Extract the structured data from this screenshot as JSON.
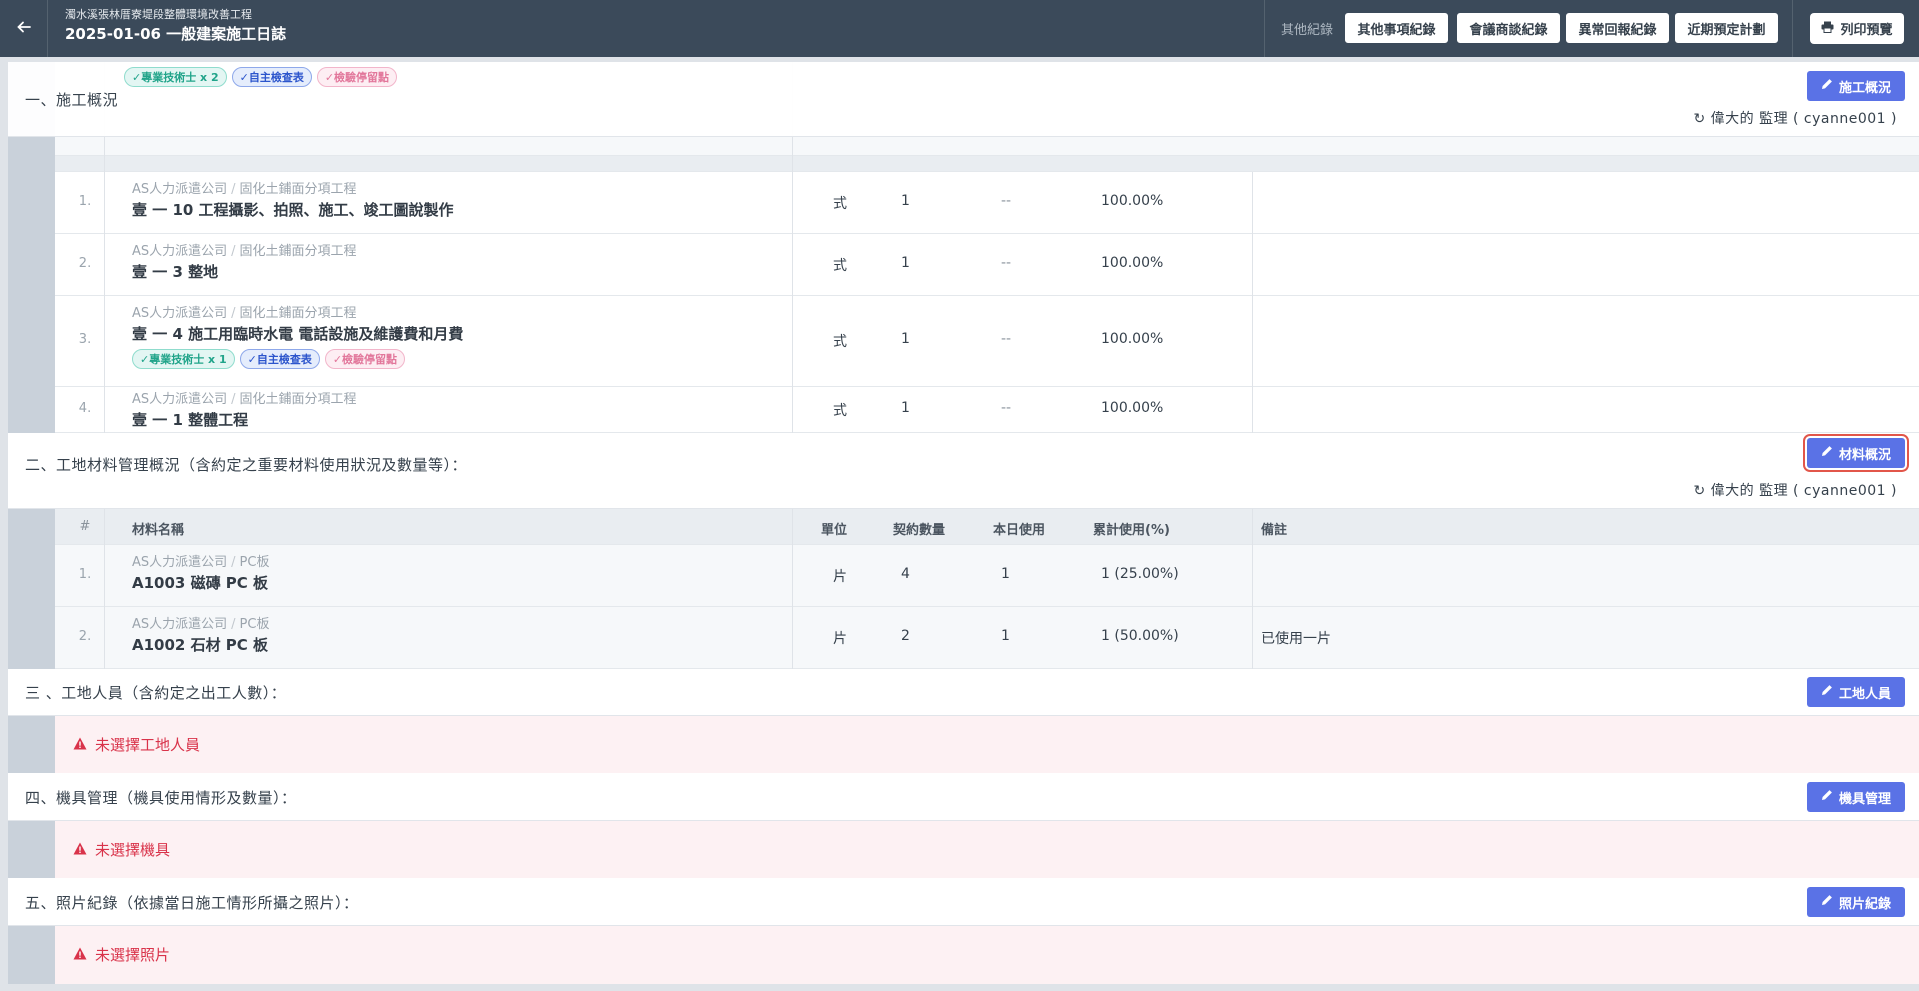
{
  "header": {
    "subtitle": "濁水溪張林厝寮堤段整體環境改善工程",
    "title": "2025-01-06 一般建案施工日誌",
    "other_records_label": "其他紀錄",
    "buttons": [
      "其他事項紀錄",
      "會議商談紀錄",
      "異常回報紀錄",
      "近期預定計劃"
    ],
    "print_label": "列印預覽"
  },
  "section1": {
    "label": "一、施工概況",
    "button": "施工概況",
    "supervisor": "偉大的 監理 ( cyanne001 )",
    "top_tags": [
      "✓專業技術士 x 2",
      "✓自主檢查表",
      "✓檢驗停留點"
    ],
    "rows": [
      {
        "no": "1.",
        "company": "AS人力派遣公司",
        "category": "固化土鋪面分項工程",
        "name": "壹 一 10 工程攝影、拍照、施工、竣工圖說製作",
        "unit": "式",
        "qty": "1",
        "today": "--",
        "cum": "100.00%"
      },
      {
        "no": "2.",
        "company": "AS人力派遣公司",
        "category": "固化土鋪面分項工程",
        "name": "壹 一 3 整地",
        "unit": "式",
        "qty": "1",
        "today": "--",
        "cum": "100.00%"
      },
      {
        "no": "3.",
        "company": "AS人力派遣公司",
        "category": "固化土鋪面分項工程",
        "name": "壹 一 4 施工用臨時水電 電話設施及維護費和月費",
        "unit": "式",
        "qty": "1",
        "today": "--",
        "cum": "100.00%",
        "tags": [
          "✓專業技術士 x 1",
          "✓自主檢查表",
          "✓檢驗停留點"
        ]
      },
      {
        "no": "4.",
        "company": "AS人力派遣公司",
        "category": "固化土鋪面分項工程",
        "name": "壹 一 1 整體工程",
        "unit": "式",
        "qty": "1",
        "today": "--",
        "cum": "100.00%"
      }
    ]
  },
  "section2": {
    "label": "二、工地材料管理概況（含約定之重要材料使用狀況及數量等）：",
    "button": "材料概況",
    "supervisor": "偉大的 監理 ( cyanne001 )",
    "columns": {
      "no": "#",
      "name": "材料名稱",
      "unit": "單位",
      "qty": "契約數量",
      "today": "本日使用",
      "cum": "累計使用(%)",
      "note": "備註"
    },
    "rows": [
      {
        "no": "1.",
        "company": "AS人力派遣公司",
        "category": "PC板",
        "name": "A1003 磁磚 PC 板",
        "unit": "片",
        "qty": "4",
        "today": "1",
        "cum": "1 (25.00%)",
        "note": ""
      },
      {
        "no": "2.",
        "company": "AS人力派遣公司",
        "category": "PC板",
        "name": "A1002 石材 PC 板",
        "unit": "片",
        "qty": "2",
        "today": "1",
        "cum": "1 (50.00%)",
        "note": "已使用一片"
      }
    ]
  },
  "section3": {
    "label": "三 、工地人員（含約定之出工人數）：",
    "button": "工地人員",
    "warning": "未選擇工地人員"
  },
  "section4": {
    "label": "四、機具管理（機具使用情形及數量）：",
    "button": "機具管理",
    "warning": "未選擇機具"
  },
  "section5": {
    "label": "五、照片紀錄（依據當日施工情形所攝之照片）：",
    "button": "照片紀錄",
    "warning": "未選擇照片"
  }
}
